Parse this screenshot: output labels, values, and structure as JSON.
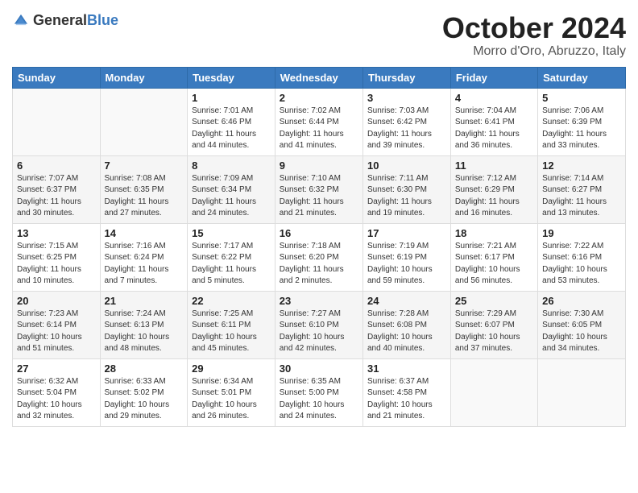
{
  "logo": {
    "general": "General",
    "blue": "Blue"
  },
  "title": "October 2024",
  "location": "Morro d'Oro, Abruzzo, Italy",
  "headers": [
    "Sunday",
    "Monday",
    "Tuesday",
    "Wednesday",
    "Thursday",
    "Friday",
    "Saturday"
  ],
  "weeks": [
    [
      {
        "day": "",
        "info": ""
      },
      {
        "day": "",
        "info": ""
      },
      {
        "day": "1",
        "info": "Sunrise: 7:01 AM\nSunset: 6:46 PM\nDaylight: 11 hours and 44 minutes."
      },
      {
        "day": "2",
        "info": "Sunrise: 7:02 AM\nSunset: 6:44 PM\nDaylight: 11 hours and 41 minutes."
      },
      {
        "day": "3",
        "info": "Sunrise: 7:03 AM\nSunset: 6:42 PM\nDaylight: 11 hours and 39 minutes."
      },
      {
        "day": "4",
        "info": "Sunrise: 7:04 AM\nSunset: 6:41 PM\nDaylight: 11 hours and 36 minutes."
      },
      {
        "day": "5",
        "info": "Sunrise: 7:06 AM\nSunset: 6:39 PM\nDaylight: 11 hours and 33 minutes."
      }
    ],
    [
      {
        "day": "6",
        "info": "Sunrise: 7:07 AM\nSunset: 6:37 PM\nDaylight: 11 hours and 30 minutes."
      },
      {
        "day": "7",
        "info": "Sunrise: 7:08 AM\nSunset: 6:35 PM\nDaylight: 11 hours and 27 minutes."
      },
      {
        "day": "8",
        "info": "Sunrise: 7:09 AM\nSunset: 6:34 PM\nDaylight: 11 hours and 24 minutes."
      },
      {
        "day": "9",
        "info": "Sunrise: 7:10 AM\nSunset: 6:32 PM\nDaylight: 11 hours and 21 minutes."
      },
      {
        "day": "10",
        "info": "Sunrise: 7:11 AM\nSunset: 6:30 PM\nDaylight: 11 hours and 19 minutes."
      },
      {
        "day": "11",
        "info": "Sunrise: 7:12 AM\nSunset: 6:29 PM\nDaylight: 11 hours and 16 minutes."
      },
      {
        "day": "12",
        "info": "Sunrise: 7:14 AM\nSunset: 6:27 PM\nDaylight: 11 hours and 13 minutes."
      }
    ],
    [
      {
        "day": "13",
        "info": "Sunrise: 7:15 AM\nSunset: 6:25 PM\nDaylight: 11 hours and 10 minutes."
      },
      {
        "day": "14",
        "info": "Sunrise: 7:16 AM\nSunset: 6:24 PM\nDaylight: 11 hours and 7 minutes."
      },
      {
        "day": "15",
        "info": "Sunrise: 7:17 AM\nSunset: 6:22 PM\nDaylight: 11 hours and 5 minutes."
      },
      {
        "day": "16",
        "info": "Sunrise: 7:18 AM\nSunset: 6:20 PM\nDaylight: 11 hours and 2 minutes."
      },
      {
        "day": "17",
        "info": "Sunrise: 7:19 AM\nSunset: 6:19 PM\nDaylight: 10 hours and 59 minutes."
      },
      {
        "day": "18",
        "info": "Sunrise: 7:21 AM\nSunset: 6:17 PM\nDaylight: 10 hours and 56 minutes."
      },
      {
        "day": "19",
        "info": "Sunrise: 7:22 AM\nSunset: 6:16 PM\nDaylight: 10 hours and 53 minutes."
      }
    ],
    [
      {
        "day": "20",
        "info": "Sunrise: 7:23 AM\nSunset: 6:14 PM\nDaylight: 10 hours and 51 minutes."
      },
      {
        "day": "21",
        "info": "Sunrise: 7:24 AM\nSunset: 6:13 PM\nDaylight: 10 hours and 48 minutes."
      },
      {
        "day": "22",
        "info": "Sunrise: 7:25 AM\nSunset: 6:11 PM\nDaylight: 10 hours and 45 minutes."
      },
      {
        "day": "23",
        "info": "Sunrise: 7:27 AM\nSunset: 6:10 PM\nDaylight: 10 hours and 42 minutes."
      },
      {
        "day": "24",
        "info": "Sunrise: 7:28 AM\nSunset: 6:08 PM\nDaylight: 10 hours and 40 minutes."
      },
      {
        "day": "25",
        "info": "Sunrise: 7:29 AM\nSunset: 6:07 PM\nDaylight: 10 hours and 37 minutes."
      },
      {
        "day": "26",
        "info": "Sunrise: 7:30 AM\nSunset: 6:05 PM\nDaylight: 10 hours and 34 minutes."
      }
    ],
    [
      {
        "day": "27",
        "info": "Sunrise: 6:32 AM\nSunset: 5:04 PM\nDaylight: 10 hours and 32 minutes."
      },
      {
        "day": "28",
        "info": "Sunrise: 6:33 AM\nSunset: 5:02 PM\nDaylight: 10 hours and 29 minutes."
      },
      {
        "day": "29",
        "info": "Sunrise: 6:34 AM\nSunset: 5:01 PM\nDaylight: 10 hours and 26 minutes."
      },
      {
        "day": "30",
        "info": "Sunrise: 6:35 AM\nSunset: 5:00 PM\nDaylight: 10 hours and 24 minutes."
      },
      {
        "day": "31",
        "info": "Sunrise: 6:37 AM\nSunset: 4:58 PM\nDaylight: 10 hours and 21 minutes."
      },
      {
        "day": "",
        "info": ""
      },
      {
        "day": "",
        "info": ""
      }
    ]
  ]
}
